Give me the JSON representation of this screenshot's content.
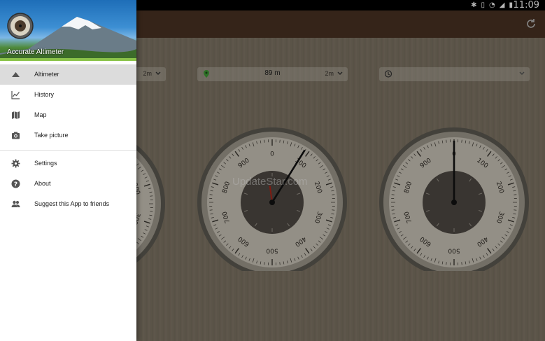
{
  "status_bar": {
    "time": "11:09"
  },
  "drawer": {
    "app_name": "Accurate Altimeter",
    "items": [
      {
        "label": "Altimeter",
        "icon": "mountain-icon",
        "active": true
      },
      {
        "label": "History",
        "icon": "chart-line-icon"
      },
      {
        "label": "Map",
        "icon": "map-icon"
      },
      {
        "label": "Take picture",
        "icon": "camera-icon"
      }
    ],
    "secondary_items": [
      {
        "label": "Settings",
        "icon": "gear-icon"
      },
      {
        "label": "About",
        "icon": "help-icon"
      },
      {
        "label": "Suggest this App to friends",
        "icon": "people-icon"
      }
    ]
  },
  "main": {
    "gps_field": {
      "value": "89 m",
      "unit": "2m"
    },
    "left_field": {
      "unit": "2m"
    },
    "gauge_scale": [
      "0",
      "100",
      "200",
      "300",
      "400",
      "500",
      "600",
      "700",
      "800",
      "900"
    ]
  },
  "watermark": "UpdateStar.com",
  "colors": {
    "toolbar": "#4a3323",
    "header_accent": "#8bc34a",
    "active_item": "#dcdcdc"
  }
}
